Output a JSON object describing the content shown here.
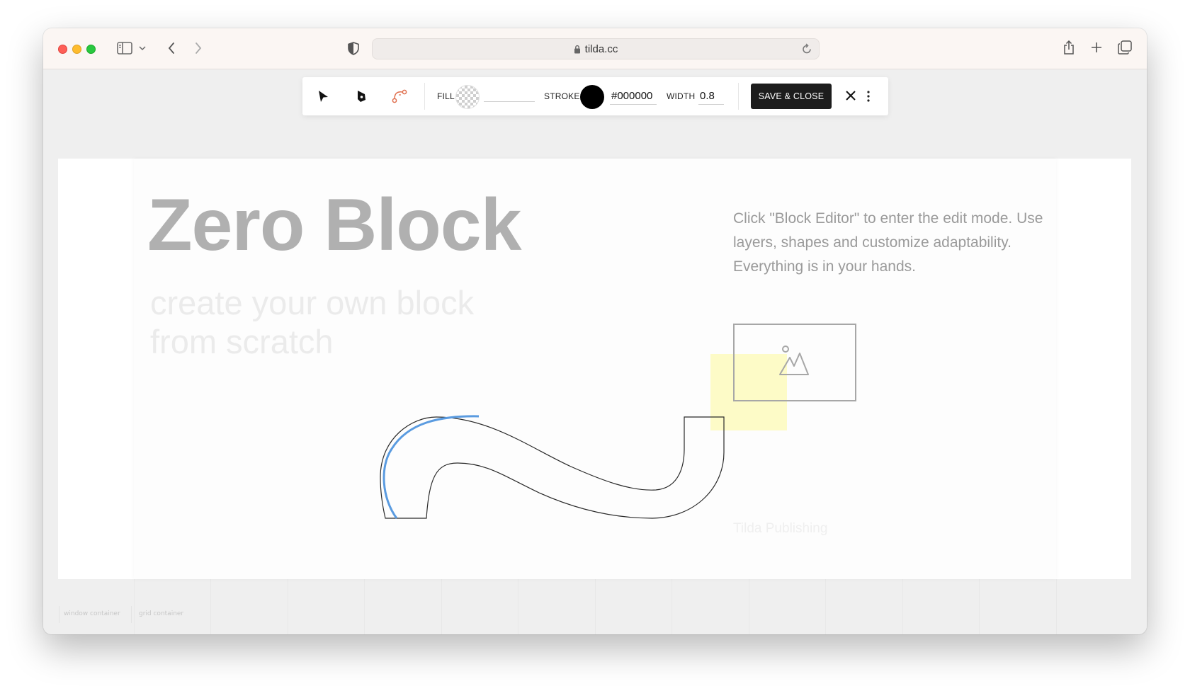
{
  "browser": {
    "url": "tilda.cc"
  },
  "toolbar": {
    "fill_label": "FILL",
    "fill_value": "",
    "stroke_label": "STROKE",
    "stroke_value": "#000000",
    "width_label": "WIDTH",
    "width_value": "0.8",
    "save_label": "SAVE & CLOSE",
    "tools": [
      "select-arrow-icon",
      "direct-select-icon",
      "bezier-pen-icon"
    ],
    "stroke_color": "#000000",
    "accent_color": "#e0704f"
  },
  "canvas": {
    "title": "Zero Block",
    "subtitle": "create your own block from scratch",
    "description": "Click \"Block Editor\" to enter the edit mode. Use layers, shapes and customize adaptability. Everything is in your hands.",
    "footer_text": "Tilda Publishing",
    "image_icon": "image-placeholder-icon",
    "highlight_color": "#fdfbc7",
    "selection_color": "#5a9be0"
  },
  "bottom_labels": {
    "window": "window container",
    "grid": "grid container"
  }
}
